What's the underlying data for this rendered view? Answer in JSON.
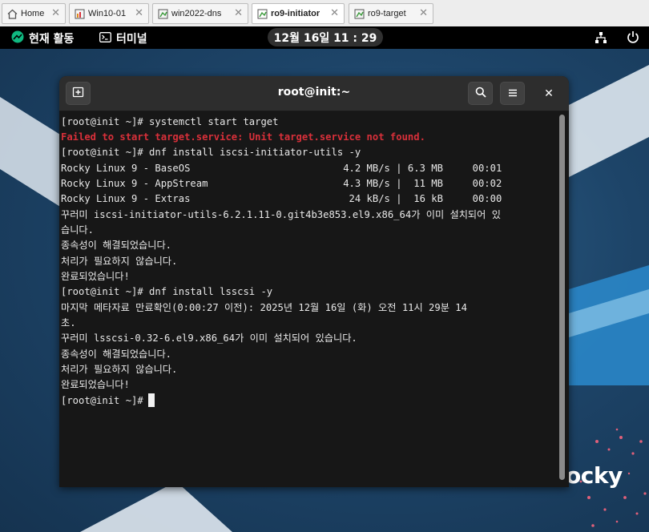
{
  "vm_tabs": [
    {
      "label": "Home",
      "icon": "home-icon",
      "active": false
    },
    {
      "label": "Win10-01",
      "icon": "vm-icon",
      "active": false
    },
    {
      "label": "win2022-dns",
      "icon": "vm-icon",
      "active": false
    },
    {
      "label": "ro9-initiator",
      "icon": "vm-icon",
      "active": true
    },
    {
      "label": "ro9-target",
      "icon": "vm-icon",
      "active": false
    }
  ],
  "topbar": {
    "activities": "현재 활동",
    "app_menu": "터미널",
    "clock": "12월 16일  11 : 29"
  },
  "terminal": {
    "title": "root@init:~",
    "lines": [
      {
        "text": "[root@init ~]# systemctl start target",
        "type": "normal"
      },
      {
        "text": "Failed to start target.service: Unit target.service not found.",
        "type": "error"
      },
      {
        "text": "[root@init ~]# dnf install iscsi-initiator-utils -y",
        "type": "normal"
      },
      {
        "text": "Rocky Linux 9 - BaseOS                          4.2 MB/s | 6.3 MB     00:01",
        "type": "normal"
      },
      {
        "text": "Rocky Linux 9 - AppStream                       4.3 MB/s |  11 MB     00:02",
        "type": "normal"
      },
      {
        "text": "Rocky Linux 9 - Extras                           24 kB/s |  16 kB     00:00",
        "type": "normal"
      },
      {
        "text": "꾸러미 iscsi-initiator-utils-6.2.1.11-0.git4b3e853.el9.x86_64가 이미 설치되어 있",
        "type": "normal"
      },
      {
        "text": "습니다.",
        "type": "normal"
      },
      {
        "text": "종속성이 해결되었습니다.",
        "type": "normal"
      },
      {
        "text": "처리가 필요하지 않습니다.",
        "type": "normal"
      },
      {
        "text": "완료되었습니다!",
        "type": "normal"
      },
      {
        "text": "[root@init ~]# dnf install lsscsi -y",
        "type": "normal"
      },
      {
        "text": "마지막 메타자료 만료확인(0:00:27 이전): 2025년 12월 16일 (화) 오전 11시 29분 14",
        "type": "normal"
      },
      {
        "text": "초.",
        "type": "normal"
      },
      {
        "text": "꾸러미 lsscsi-0.32-6.el9.x86_64가 이미 설치되어 있습니다.",
        "type": "normal"
      },
      {
        "text": "종속성이 해결되었습니다.",
        "type": "normal"
      },
      {
        "text": "처리가 필요하지 않습니다.",
        "type": "normal"
      },
      {
        "text": "완료되었습니다!",
        "type": "normal"
      },
      {
        "text": "[root@init ~]#",
        "type": "prompt"
      }
    ]
  },
  "desktop": {
    "logo_text": "ocky"
  },
  "colors": {
    "error": "#d9303a",
    "terminal_bg": "#171717",
    "header_bg": "#2d2d2d",
    "topbar_bg": "#000000",
    "desktop_bg": "#1d4468"
  }
}
